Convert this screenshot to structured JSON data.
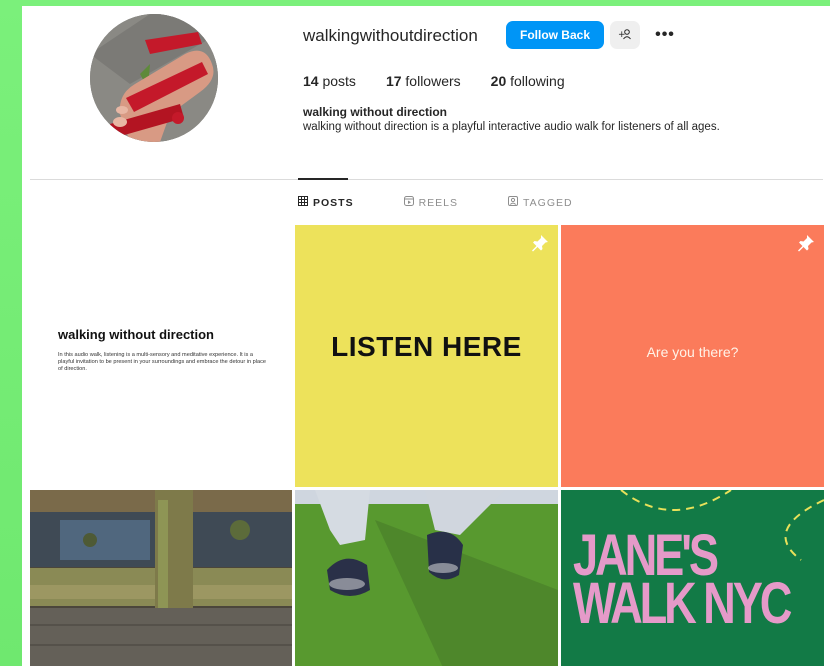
{
  "profile": {
    "username": "walkingwithoutdirection",
    "follow_back_label": "Follow Back",
    "suggest_icon": "+♀",
    "more_icon": "•••",
    "stats": {
      "posts_count": "14",
      "posts_label": "posts",
      "followers_count": "17",
      "followers_label": "followers",
      "following_count": "20",
      "following_label": "following"
    },
    "bio_name": "walking without direction",
    "bio_text": "walking without direction is a playful interactive audio walk for listeners of all ages."
  },
  "tabs": [
    {
      "label": "POSTS",
      "icon": "grid-icon",
      "active": true
    },
    {
      "label": "REELS",
      "icon": "reels-icon",
      "active": false
    },
    {
      "label": "TAGGED",
      "icon": "tagged-icon",
      "active": false
    }
  ],
  "posts": {
    "post1": {
      "title": "walking without direction",
      "body": "In this audio walk, listening is a multi-sensory and meditative experience. It is a playful invitation to be present in your surroundings and embrace the detour in place of direction."
    },
    "post2": {
      "text": "LISTEN HERE",
      "pinned": true,
      "color": "#ede25b"
    },
    "post3": {
      "text": "Are you there?",
      "pinned": true,
      "color": "#fb7b5b"
    },
    "post6": {
      "line1": "JANE'S",
      "line2": "WALK NYC",
      "color": "#127a46",
      "text_color": "#e59ac9"
    }
  },
  "colors": {
    "accent": "#0095f6",
    "background": "#ffffff",
    "page_bg": "#7bf07b"
  }
}
